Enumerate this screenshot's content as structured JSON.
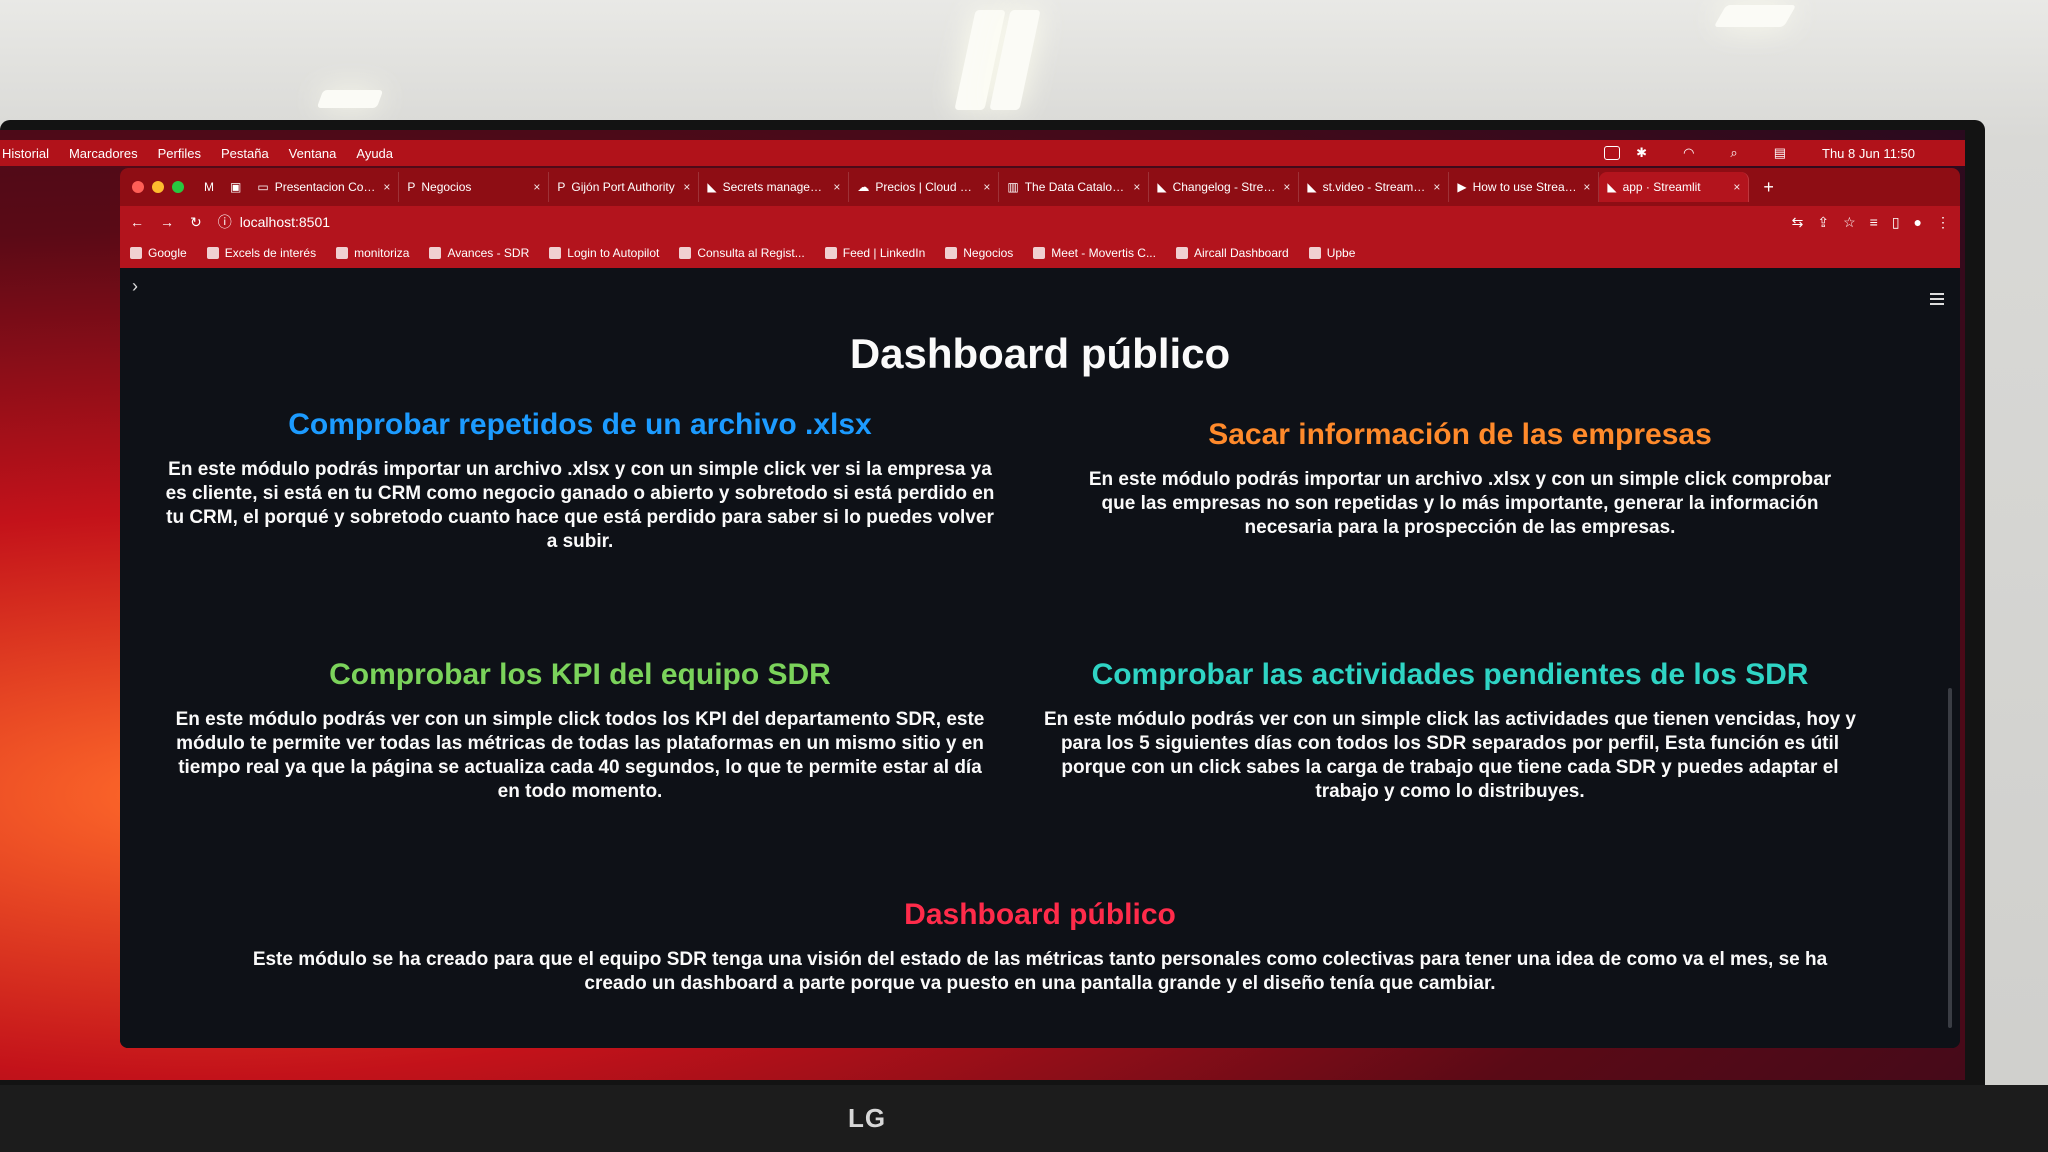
{
  "menubar": {
    "items": [
      "Historial",
      "Marcadores",
      "Perfiles",
      "Pestaña",
      "Ventana",
      "Ayuda"
    ],
    "clock": "Thu 8 Jun 11:50"
  },
  "tabs": [
    {
      "label": "Presentacion Comer",
      "icon": "slides-icon"
    },
    {
      "label": "Negocios",
      "icon": "p-icon"
    },
    {
      "label": "Gijón Port Authority",
      "icon": "p-icon"
    },
    {
      "label": "Secrets managemen",
      "icon": "streamlit-icon"
    },
    {
      "label": "Precios | Cloud Sto",
      "icon": "cloud-icon"
    },
    {
      "label": "The Data Catalog —",
      "icon": "doc-icon"
    },
    {
      "label": "Changelog - Stream",
      "icon": "streamlit-icon"
    },
    {
      "label": "st.video - Streamlit D",
      "icon": "streamlit-icon"
    },
    {
      "label": "How to use Streamli",
      "icon": "youtube-icon"
    },
    {
      "label": "app · Streamlit",
      "icon": "streamlit-icon",
      "active": true
    }
  ],
  "toolbar": {
    "url": "localhost:8501"
  },
  "bookmarks": [
    "Google",
    "Excels de interés",
    "monitoriza",
    "Avances - SDR",
    "Login to Autopilot",
    "Consulta al Regist...",
    "Feed | LinkedIn",
    "Negocios",
    "Meet - Movertis C...",
    "Aircall Dashboard",
    "Upbe"
  ],
  "page": {
    "title": "Dashboard público",
    "cards": [
      {
        "title": "Comprobar repetidos de un archivo .xlsx",
        "color": "#1c9bff",
        "text": "En este módulo podrás importar un archivo .xlsx y con un simple click ver si la empresa ya es cliente, si está en tu CRM como negocio ganado o abierto y sobretodo si está perdido en tu CRM, el porqué y sobretodo cuanto hace que está perdido para saber si lo puedes volver a subir."
      },
      {
        "title": "Sacar información de las empresas",
        "color": "#ff8a2b",
        "text": "En este módulo podrás importar un archivo .xlsx y con un simple click comprobar que las empresas no son repetidas y lo más importante, generar la información necesaria para la prospección de las empresas."
      },
      {
        "title": "Comprobar los KPI del equipo SDR",
        "color": "#7bd35b",
        "text": "En este módulo podrás ver con un simple click todos los KPI del departamento SDR, este módulo te permite ver todas las métricas de todas las plataformas en un mismo sitio y en tiempo real ya que la página se actualiza cada 40 segundos, lo que te permite estar al día en todo momento."
      },
      {
        "title": "Comprobar las actividades pendientes de los SDR",
        "color": "#2fd4c4",
        "text": "En este módulo podrás ver con un simple click las actividades que tienen vencidas, hoy y para los 5 siguientes días con todos los SDR separados por perfil, Esta función es útil porque con un click sabes la carga de trabajo que tiene cada SDR y puedes adaptar el trabajo y como lo distribuyes."
      },
      {
        "title": "Dashboard público",
        "color": "#ff2b4a",
        "text": "Este módulo se ha creado para que el equipo SDR tenga una visión del estado de las métricas tanto personales como colectivas para tener una idea de como va el mes, se ha creado un dashboard a parte porque va puesto en una pantalla grande y el diseño tenía que cambiar."
      }
    ]
  },
  "monitor": {
    "brand": "LG"
  }
}
